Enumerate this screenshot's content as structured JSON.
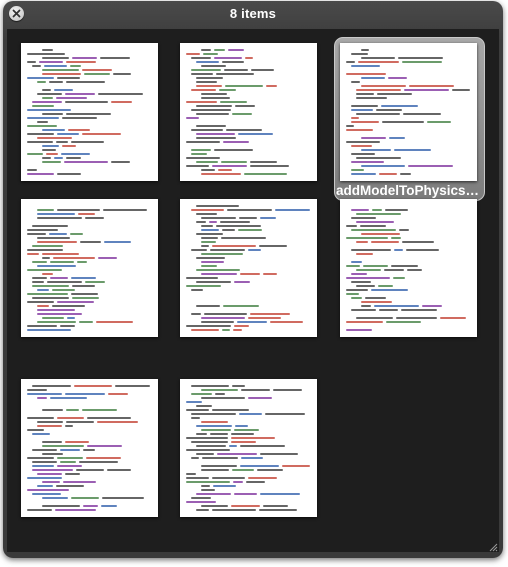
{
  "window": {
    "title": "8 items"
  },
  "items": [
    {
      "caption": ""
    },
    {
      "caption": ""
    },
    {
      "caption": "addModelToPhysicsWorld.cs"
    },
    {
      "caption": ""
    },
    {
      "caption": ""
    },
    {
      "caption": ""
    },
    {
      "caption": ""
    },
    {
      "caption": ""
    }
  ],
  "selected_index": 2,
  "colors": {
    "code_text": "#333333",
    "keyword": "#7a2a9a",
    "string": "#c0392b",
    "comment": "#3a7a3a",
    "type": "#2a5aa8"
  },
  "icons": {
    "close": "close-icon",
    "resize": "resize-grip-icon"
  }
}
